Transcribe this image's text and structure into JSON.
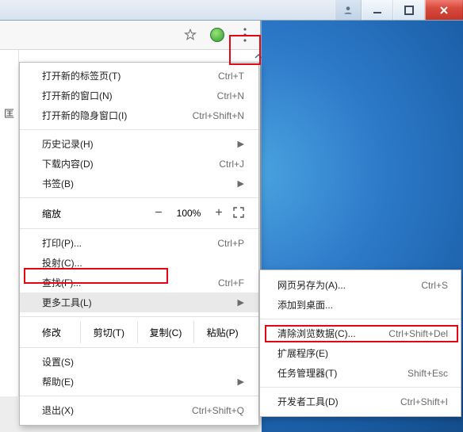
{
  "window_controls": {
    "profile_icon": "profile",
    "minimize": "—",
    "maximize": "❐",
    "close": "✕"
  },
  "left_strip_text": "匡",
  "menu": {
    "new_tab": {
      "label": "打开新的标签页(T)",
      "accel": "Ctrl+T"
    },
    "new_window": {
      "label": "打开新的窗口(N)",
      "accel": "Ctrl+N"
    },
    "new_incognito": {
      "label": "打开新的隐身窗口(I)",
      "accel": "Ctrl+Shift+N"
    },
    "history": {
      "label": "历史记录(H)"
    },
    "downloads": {
      "label": "下载内容(D)",
      "accel": "Ctrl+J"
    },
    "bookmarks": {
      "label": "书签(B)"
    },
    "zoom_label": "缩放",
    "zoom_value": "100%",
    "print": {
      "label": "打印(P)...",
      "accel": "Ctrl+P"
    },
    "cast": {
      "label": "投射(C)..."
    },
    "find": {
      "label": "查找(F)...",
      "accel": "Ctrl+F"
    },
    "more_tools": {
      "label": "更多工具(L)"
    },
    "edit_label": "修改",
    "cut": "剪切(T)",
    "copy": "复制(C)",
    "paste": "粘贴(P)",
    "settings": {
      "label": "设置(S)"
    },
    "help": {
      "label": "帮助(E)"
    },
    "exit": {
      "label": "退出(X)",
      "accel": "Ctrl+Shift+Q"
    }
  },
  "submenu": {
    "save_as": {
      "label": "网页另存为(A)...",
      "accel": "Ctrl+S"
    },
    "add_to_desktop": {
      "label": "添加到桌面..."
    },
    "clear_browsing": {
      "label": "清除浏览数据(C)...",
      "accel": "Ctrl+Shift+Del"
    },
    "extensions": {
      "label": "扩展程序(E)"
    },
    "task_manager": {
      "label": "任务管理器(T)",
      "accel": "Shift+Esc"
    },
    "developer_tools": {
      "label": "开发者工具(D)",
      "accel": "Ctrl+Shift+I"
    }
  }
}
